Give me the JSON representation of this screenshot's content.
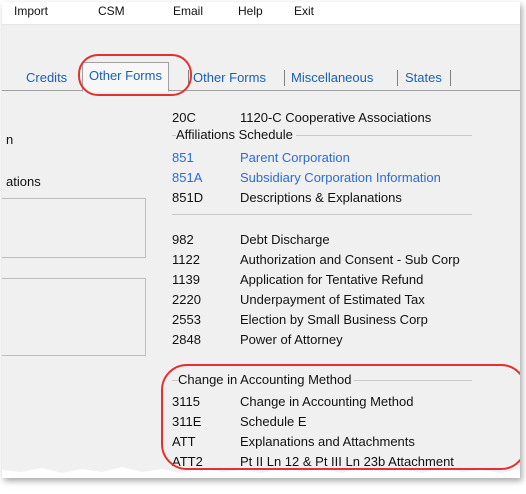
{
  "menu": [
    "Import",
    "CSM",
    "Email",
    "Help",
    "Exit"
  ],
  "tabs": {
    "credits": "Credits",
    "other_forms_active": "Other Forms",
    "other_forms": "Other Forms",
    "miscellaneous": "Miscellaneous",
    "states": "States"
  },
  "left_panel": {
    "partial_label_1": "n",
    "partial_label_2": "ations"
  },
  "forms_top": [
    {
      "code": "20C",
      "desc": "1120-C Cooperative Associations"
    }
  ],
  "affiliations": {
    "title": "Affiliations Schedule",
    "items": [
      {
        "code": "851",
        "desc": "Parent Corporation"
      },
      {
        "code": "851A",
        "desc": "Subsidiary Corporation Information"
      },
      {
        "code": "851D",
        "desc": "Descriptions & Explanations"
      }
    ]
  },
  "forms_mid": [
    {
      "code": "982",
      "desc": "Debt Discharge"
    },
    {
      "code": "1122",
      "desc": "Authorization and Consent - Sub Corp"
    },
    {
      "code": "1139",
      "desc": "Application for Tentative Refund"
    },
    {
      "code": "2220",
      "desc": "Underpayment of Estimated Tax"
    },
    {
      "code": "2553",
      "desc": "Election by Small Business Corp"
    },
    {
      "code": "2848",
      "desc": "Power of Attorney"
    }
  ],
  "accounting": {
    "title": "Change in Accounting Method",
    "items": [
      {
        "code": "3115",
        "desc": "Change in Accounting Method"
      },
      {
        "code": "311E",
        "desc": "Schedule E"
      },
      {
        "code": "ATT",
        "desc": "Explanations and Attachments"
      },
      {
        "code": "ATT2",
        "desc": "Pt II Ln 12 & Pt III Ln 23b Attachment"
      }
    ]
  },
  "colors": {
    "link": "#2b6cd6",
    "highlight": "#e53030",
    "tab_text": "#1a5fb4"
  }
}
